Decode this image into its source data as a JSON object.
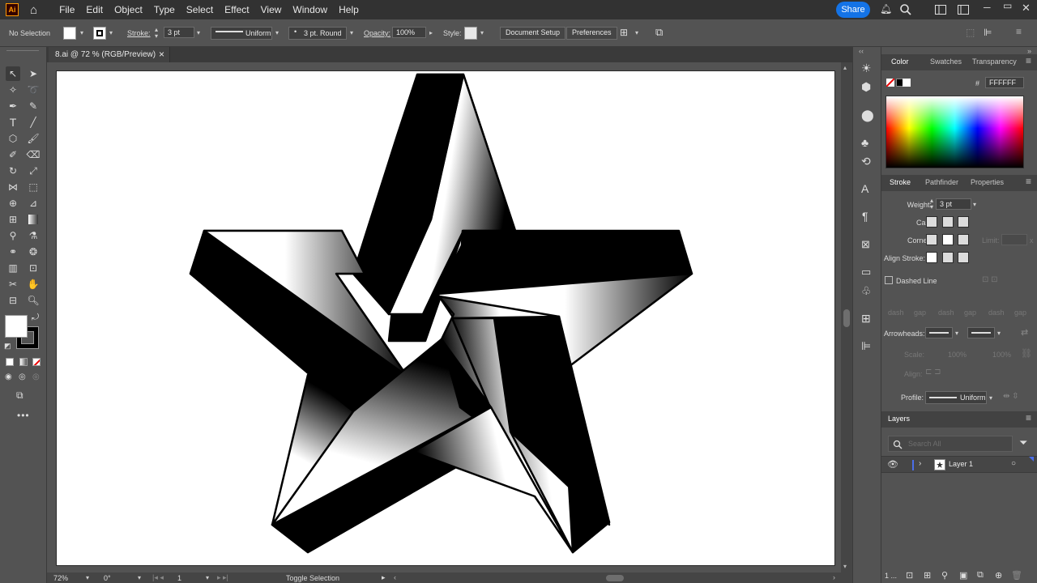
{
  "app": {
    "logo": "Ai"
  },
  "menu": [
    "File",
    "Edit",
    "Object",
    "Type",
    "Select",
    "Effect",
    "View",
    "Window",
    "Help"
  ],
  "share_label": "Share",
  "control": {
    "selection": "No Selection",
    "stroke_label": "Stroke:",
    "stroke_weight": "3 pt",
    "profile": "Uniform",
    "brush": "3 pt. Round",
    "opacity_label": "Opacity:",
    "opacity": "100%",
    "style_label": "Style:",
    "doc_setup": "Document Setup",
    "preferences": "Preferences"
  },
  "document": {
    "tab_title": "8.ai @ 72 % (RGB/Preview)",
    "close": "×"
  },
  "status": {
    "zoom": "72%",
    "rotation": "0°",
    "artboard": "1",
    "tool_hint": "Toggle Selection"
  },
  "color_panel": {
    "tabs": [
      "Color",
      "Swatches",
      "Transparency"
    ],
    "hex_symbol": "#",
    "hex": "FFFFFF"
  },
  "stroke_panel": {
    "tabs": [
      "Stroke",
      "Pathfinder",
      "Properties"
    ],
    "weight_label": "Weight:",
    "weight": "3 pt",
    "cap_label": "Cap:",
    "corner_label": "Corner:",
    "limit_label": "Limit:",
    "limit_unit": "x",
    "align_label": "Align Stroke:",
    "dashed_label": "Dashed Line",
    "dash_labels": [
      "dash",
      "gap",
      "dash",
      "gap",
      "dash",
      "gap"
    ],
    "arrowheads_label": "Arrowheads:",
    "scale_label": "Scale:",
    "scale_values": [
      "100%",
      "100%"
    ],
    "align_arrow_label": "Align:",
    "profile_label": "Profile:",
    "profile": "Uniform"
  },
  "layers_panel": {
    "title": "Layers",
    "search_placeholder": "Search All",
    "layer_name": "Layer 1",
    "footer_count": "1 ..."
  },
  "colors": {
    "accent": "#1473e6",
    "panel": "#535353",
    "dark": "#323232",
    "layer_color": "#4b6ee8"
  }
}
